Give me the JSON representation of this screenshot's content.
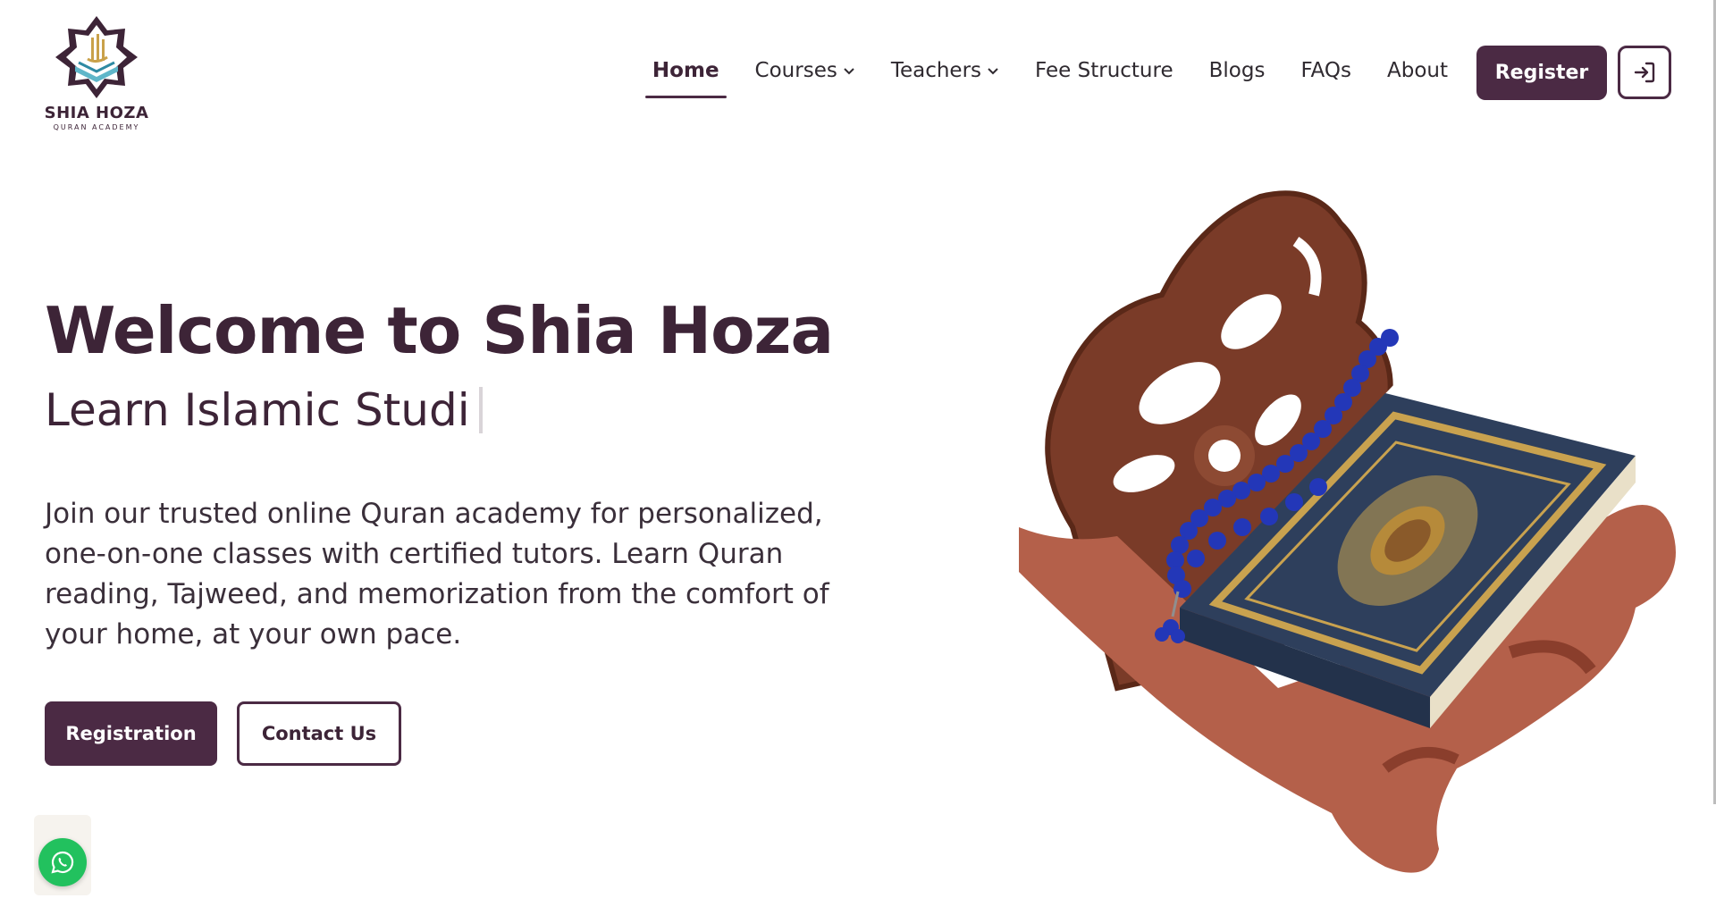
{
  "brand": {
    "name": "SHIA HOZA",
    "tagline": "QURAN ACADEMY",
    "logo_icon": "star-book-logo",
    "primary_color": "#4b2a44",
    "accent_color": "#3d2437"
  },
  "nav": {
    "items": [
      {
        "label": "Home",
        "active": true,
        "dropdown": false
      },
      {
        "label": "Courses",
        "active": false,
        "dropdown": true
      },
      {
        "label": "Teachers",
        "active": false,
        "dropdown": true
      },
      {
        "label": "Fee Structure",
        "active": false,
        "dropdown": false
      },
      {
        "label": "Blogs",
        "active": false,
        "dropdown": false
      },
      {
        "label": "FAQs",
        "active": false,
        "dropdown": false
      },
      {
        "label": "About",
        "active": false,
        "dropdown": false
      }
    ],
    "register_label": "Register",
    "login_icon": "sign-in-icon"
  },
  "hero": {
    "title": "Welcome to Shia Hoza",
    "subtitle_typed": "Learn Islamic Studi",
    "description": "Join our trusted online Quran academy for personalized, one-on-one classes with certified tutors. Learn Quran reading, Tajweed, and memorization from the comfort of your home, at your own pace.",
    "primary_button": "Registration",
    "secondary_button": "Contact Us",
    "image_icon": "quran-on-rehal-image"
  },
  "floating": {
    "whatsapp_icon": "whatsapp-icon",
    "whatsapp_color": "#22c15e"
  }
}
